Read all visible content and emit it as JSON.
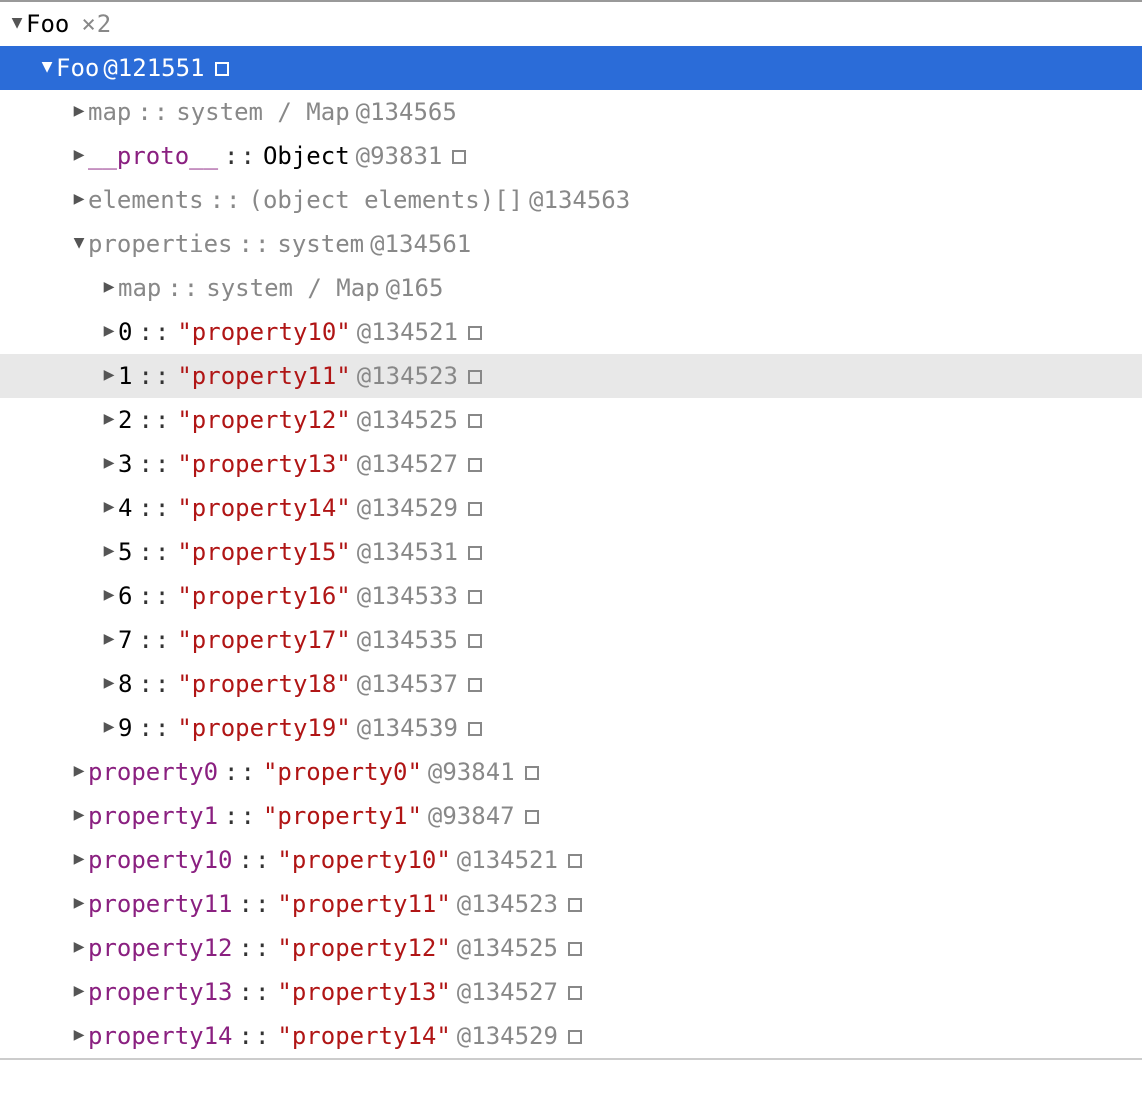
{
  "header": {
    "name": "Foo",
    "count": "×2"
  },
  "selected": {
    "name": "Foo",
    "addr": "@121551"
  },
  "children": [
    {
      "key": "map",
      "keyClass": "key-gray",
      "sepClass": "sep",
      "val": "system / Map",
      "valClass": "val-gray",
      "addr": "@134565",
      "sq": false
    },
    {
      "key": "__proto__",
      "keyClass": "key-purple",
      "sepClass": "sep-dark",
      "val": "Object",
      "valClass": "val-black",
      "addr": "@93831",
      "sq": true
    },
    {
      "key": "elements",
      "keyClass": "key-gray",
      "sepClass": "sep",
      "val": "(object elements)[]",
      "valClass": "val-gray",
      "addr": "@134563",
      "sq": false
    }
  ],
  "properties": {
    "key": "properties",
    "val": "system",
    "addr": "@134561",
    "map": {
      "key": "map",
      "val": "system / Map",
      "addr": "@165"
    },
    "items": [
      {
        "idx": "0",
        "val": "\"property10\"",
        "addr": "@134521"
      },
      {
        "idx": "1",
        "val": "\"property11\"",
        "addr": "@134523",
        "hover": true
      },
      {
        "idx": "2",
        "val": "\"property12\"",
        "addr": "@134525"
      },
      {
        "idx": "3",
        "val": "\"property13\"",
        "addr": "@134527"
      },
      {
        "idx": "4",
        "val": "\"property14\"",
        "addr": "@134529"
      },
      {
        "idx": "5",
        "val": "\"property15\"",
        "addr": "@134531"
      },
      {
        "idx": "6",
        "val": "\"property16\"",
        "addr": "@134533"
      },
      {
        "idx": "7",
        "val": "\"property17\"",
        "addr": "@134535"
      },
      {
        "idx": "8",
        "val": "\"property18\"",
        "addr": "@134537"
      },
      {
        "idx": "9",
        "val": "\"property19\"",
        "addr": "@134539"
      }
    ]
  },
  "props": [
    {
      "key": "property0",
      "val": "\"property0\"",
      "addr": "@93841"
    },
    {
      "key": "property1",
      "val": "\"property1\"",
      "addr": "@93847"
    },
    {
      "key": "property10",
      "val": "\"property10\"",
      "addr": "@134521"
    },
    {
      "key": "property11",
      "val": "\"property11\"",
      "addr": "@134523"
    },
    {
      "key": "property12",
      "val": "\"property12\"",
      "addr": "@134525"
    },
    {
      "key": "property13",
      "val": "\"property13\"",
      "addr": "@134527"
    },
    {
      "key": "property14",
      "val": "\"property14\"",
      "addr": "@134529"
    }
  ]
}
